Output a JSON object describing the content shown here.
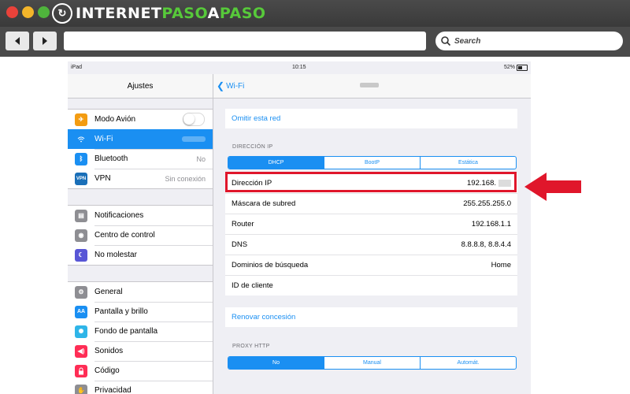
{
  "browser": {
    "logo_pre": "INTERNET",
    "logo_mid": "PASO",
    "logo_a": "A",
    "logo_post": "PASO",
    "search_placeholder": "Search",
    "back_icon": "left-arrow-icon",
    "forward_icon": "right-arrow-icon"
  },
  "status_bar": {
    "device": "iPad",
    "time": "10:15",
    "battery": "52%"
  },
  "settings": {
    "title": "Ajustes",
    "group1": [
      {
        "label": "Modo Avión",
        "icon": "airplane-icon",
        "color": "#f39c12",
        "control": "toggle"
      },
      {
        "label": "Wi-Fi",
        "icon": "wifi-icon",
        "color": "#1a8ff2",
        "selected": true
      },
      {
        "label": "Bluetooth",
        "icon": "bluetooth-icon",
        "color": "#1a8ff2",
        "value": "No"
      },
      {
        "label": "VPN",
        "icon": "vpn-icon",
        "color": "#1a6fb8",
        "value": "Sin conexión"
      }
    ],
    "group2": [
      {
        "label": "Notificaciones",
        "icon": "notifications-icon",
        "color": "#8e8e93"
      },
      {
        "label": "Centro de control",
        "icon": "control-center-icon",
        "color": "#8e8e93"
      },
      {
        "label": "No molestar",
        "icon": "moon-icon",
        "color": "#5856d6"
      }
    ],
    "group3": [
      {
        "label": "General",
        "icon": "gear-icon",
        "color": "#8e8e93"
      },
      {
        "label": "Pantalla y brillo",
        "icon": "brightness-icon",
        "color": "#1a8ff2"
      },
      {
        "label": "Fondo de pantalla",
        "icon": "wallpaper-icon",
        "color": "#2fb5e8"
      },
      {
        "label": "Sonidos",
        "icon": "sound-icon",
        "color": "#ff2d55"
      },
      {
        "label": "Código",
        "icon": "lock-icon",
        "color": "#ff2d55"
      },
      {
        "label": "Privacidad",
        "icon": "hand-icon",
        "color": "#8e8e93"
      }
    ]
  },
  "wifi_detail": {
    "back_label": "Wi-Fi",
    "forget": "Omitir esta red",
    "ip_section": "DIRECCIÓN IP",
    "ip_modes": [
      "DHCP",
      "BootP",
      "Estática"
    ],
    "ip_mode_active": "DHCP",
    "rows": [
      {
        "label": "Dirección IP",
        "value": "192.168."
      },
      {
        "label": "Máscara de subred",
        "value": "255.255.255.0"
      },
      {
        "label": "Router",
        "value": "192.168.1.1"
      },
      {
        "label": "DNS",
        "value": "8.8.8.8, 8.8.4.4"
      },
      {
        "label": "Dominios de búsqueda",
        "value": "Home"
      },
      {
        "label": "ID de cliente",
        "value": ""
      }
    ],
    "renew": "Renovar concesión",
    "proxy_section": "PROXY HTTP",
    "proxy_modes": [
      "No",
      "Manual",
      "Automát."
    ],
    "proxy_mode_active": "No"
  },
  "colors": {
    "ios_blue": "#1a8ff2",
    "highlight_red": "#e0162b",
    "logo_green": "#57c93a"
  }
}
